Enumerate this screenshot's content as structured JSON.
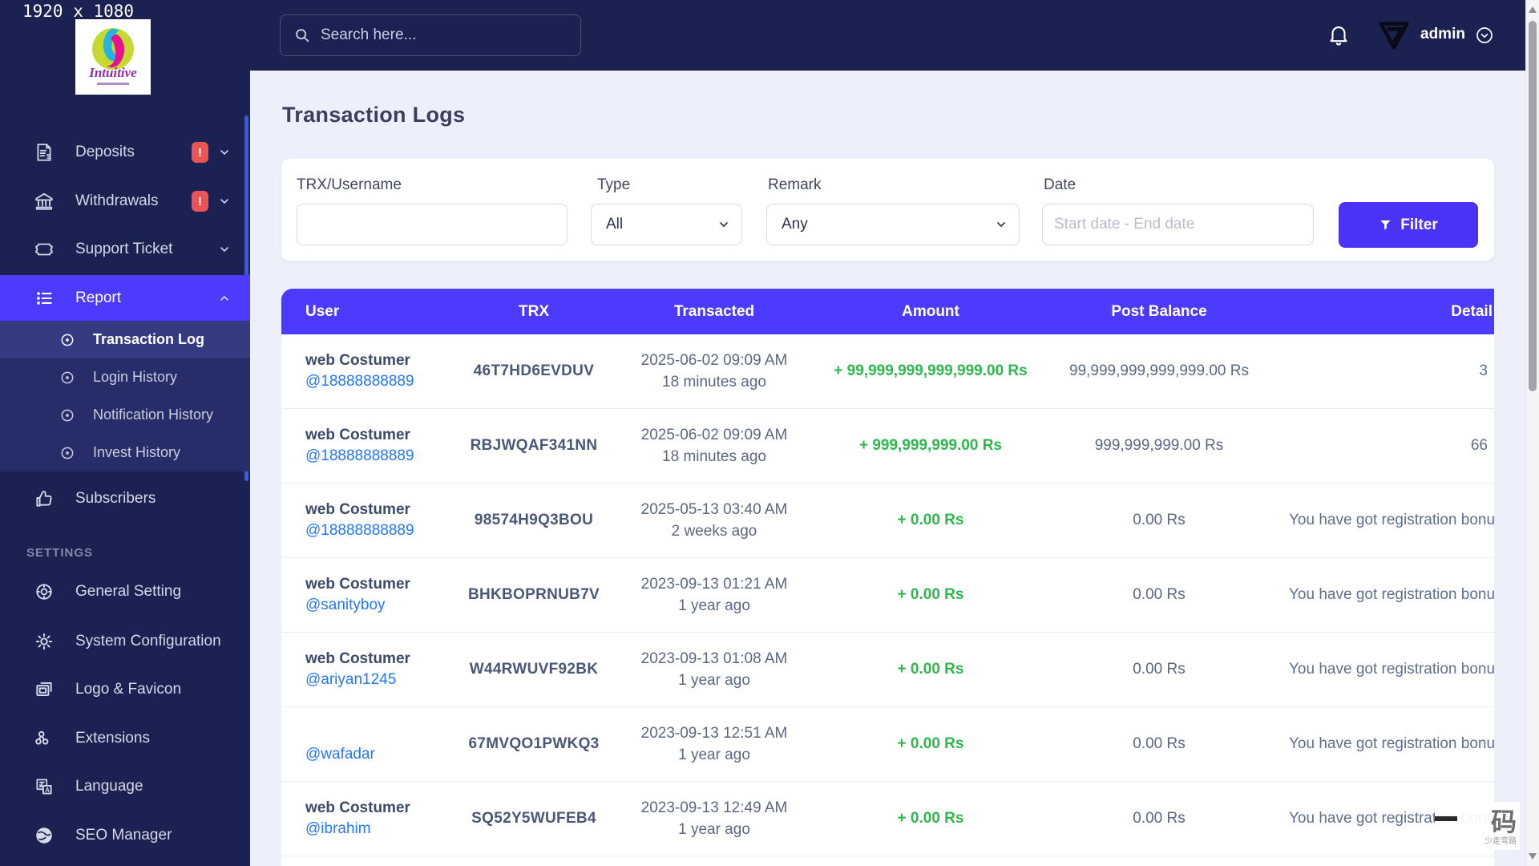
{
  "meta": {
    "screen_label": "1920 x 1080"
  },
  "colors": {
    "sidebar_bg": "#1b2150",
    "accent_purple": "#4c3bfe",
    "filter_button": "#4a33f4",
    "badge_red": "#ea5455",
    "amount_green": "#2db84d",
    "link_blue": "#2277ff",
    "content_bg": "#edeffa"
  },
  "sidebar": {
    "logo_title": "Intuitive",
    "items": [
      {
        "label": "Deposits",
        "badge": "!"
      },
      {
        "label": "Withdrawals",
        "badge": "!"
      },
      {
        "label": "Support Ticket"
      },
      {
        "label": "Report"
      }
    ],
    "report_submenu": [
      {
        "label": "Transaction Log"
      },
      {
        "label": "Login History"
      },
      {
        "label": "Notification History"
      },
      {
        "label": "Invest History"
      }
    ],
    "subscribers_label": "Subscribers",
    "settings_header": "SETTINGS",
    "settings_items": [
      {
        "label": "General Setting"
      },
      {
        "label": "System Configuration"
      },
      {
        "label": "Logo & Favicon"
      },
      {
        "label": "Extensions"
      },
      {
        "label": "Language"
      },
      {
        "label": "SEO Manager"
      }
    ]
  },
  "topbar": {
    "search_placeholder": "Search here...",
    "user_name": "admin"
  },
  "page": {
    "title": "Transaction Logs"
  },
  "filters": {
    "trx_label": "TRX/Username",
    "type_label": "Type",
    "type_value": "All",
    "remark_label": "Remark",
    "remark_value": "Any",
    "date_label": "Date",
    "date_placeholder": "Start date - End date",
    "filter_button": "Filter"
  },
  "table": {
    "headers": [
      "User",
      "TRX",
      "Transacted",
      "Amount",
      "Post Balance",
      "Detail"
    ],
    "rows": [
      {
        "name": "web Costumer",
        "username": "@18888888889",
        "trx": "46T7HD6EVDUV",
        "date": "2025-06-02 09:09 AM",
        "ago": "18 minutes ago",
        "amount": "+ 99,999,999,999,999.00 Rs",
        "post_balance": "99,999,999,999,999.00 Rs",
        "detail": "3"
      },
      {
        "name": "web Costumer",
        "username": "@18888888889",
        "trx": "RBJWQAF341NN",
        "date": "2025-06-02 09:09 AM",
        "ago": "18 minutes ago",
        "amount": "+ 999,999,999.00 Rs",
        "post_balance": "999,999,999.00 Rs",
        "detail": "66"
      },
      {
        "name": "web Costumer",
        "username": "@18888888889",
        "trx": "98574H9Q3BOU",
        "date": "2025-05-13 03:40 AM",
        "ago": "2 weeks ago",
        "amount": "+ 0.00 Rs",
        "post_balance": "0.00 Rs",
        "detail": "You have got registration bonu"
      },
      {
        "name": "web Costumer",
        "username": "@sanityboy",
        "trx": "BHKBOPRNUB7V",
        "date": "2023-09-13 01:21 AM",
        "ago": "1 year ago",
        "amount": "+ 0.00 Rs",
        "post_balance": "0.00 Rs",
        "detail": "You have got registration bonu"
      },
      {
        "name": "web Costumer",
        "username": "@ariyan1245",
        "trx": "W44RWUVF92BK",
        "date": "2023-09-13 01:08 AM",
        "ago": "1 year ago",
        "amount": "+ 0.00 Rs",
        "post_balance": "0.00 Rs",
        "detail": "You have got registration bonu"
      },
      {
        "name": "",
        "username": "@wafadar",
        "trx": "67MVQO1PWKQ3",
        "date": "2023-09-13 12:51 AM",
        "ago": "1 year ago",
        "amount": "+ 0.00 Rs",
        "post_balance": "0.00 Rs",
        "detail": "You have got registration bonu"
      },
      {
        "name": "web Costumer",
        "username": "@ibrahim",
        "trx": "SQ52Y5WUFEB4",
        "date": "2023-09-13 12:49 AM",
        "ago": "1 year ago",
        "amount": "+ 0.00 Rs",
        "post_balance": "0.00 Rs",
        "detail": "You have got registration bonu"
      }
    ]
  },
  "watermark": {
    "big_char": "码",
    "small_text": "少走弯路"
  }
}
